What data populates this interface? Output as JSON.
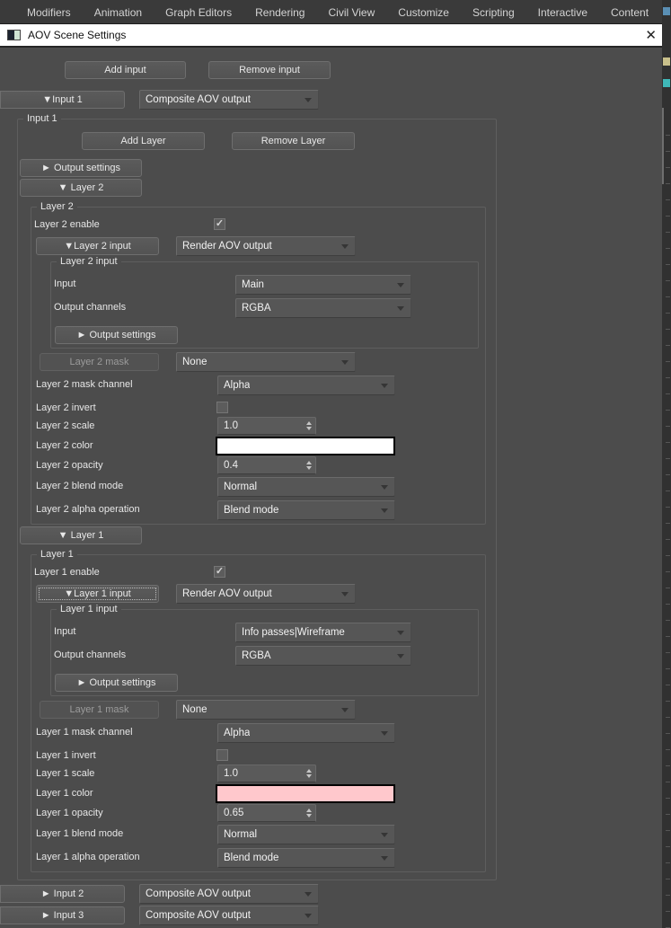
{
  "menu": {
    "items": [
      "Modifiers",
      "Animation",
      "Graph Editors",
      "Rendering",
      "Civil View",
      "Customize",
      "Scripting",
      "Interactive",
      "Content"
    ]
  },
  "titlebar": {
    "title": "AOV Scene Settings",
    "close": "✕"
  },
  "toolbar": {
    "add_input": "Add input",
    "remove_input": "Remove input"
  },
  "input1": {
    "toggle": "▼Input 1",
    "type": "Composite AOV output",
    "group_label": "Input 1",
    "add_layer": "Add Layer",
    "remove_layer": "Remove Layer",
    "output_settings": "► Output settings"
  },
  "layers": [
    {
      "toggle": "▼ Layer 2",
      "group_label": "Layer 2",
      "enable_label": "Layer 2 enable",
      "enable_check": "✓",
      "input_toggle": "▼Layer 2 input",
      "input_type": "Render AOV output",
      "input_group_label": "Layer 2 input",
      "input_label": "Input",
      "input_value": "Main",
      "channels_label": "Output channels",
      "channels_value": "RGBA",
      "output_settings": "► Output settings",
      "mask_label": "Layer 2 mask",
      "mask_value": "None",
      "mask_channel_label": "Layer 2 mask channel",
      "mask_channel_value": "Alpha",
      "invert_label": "Layer 2 invert",
      "invert_check": "",
      "scale_label": "Layer 2 scale",
      "scale_value": "1.0",
      "color_label": "Layer 2 color",
      "color_value": "#ffffff",
      "opacity_label": "Layer 2 opacity",
      "opacity_value": "0.4",
      "blend_label": "Layer 2 blend mode",
      "blend_value": "Normal",
      "alpha_label": "Layer 2 alpha operation",
      "alpha_value": "Blend mode"
    },
    {
      "toggle": "▼ Layer 1",
      "group_label": "Layer 1",
      "enable_label": "Layer 1 enable",
      "enable_check": "✓",
      "input_toggle": "▼Layer 1 input",
      "input_type": "Render AOV output",
      "input_group_label": "Layer 1 input",
      "input_label": "Input",
      "input_value": "Info passes|Wireframe",
      "channels_label": "Output channels",
      "channels_value": "RGBA",
      "output_settings": "► Output settings",
      "mask_label": "Layer 1 mask",
      "mask_value": "None",
      "mask_channel_label": "Layer 1 mask channel",
      "mask_channel_value": "Alpha",
      "invert_label": "Layer 1 invert",
      "invert_check": "",
      "scale_label": "Layer 1 scale",
      "scale_value": "1.0",
      "color_label": "Layer 1 color",
      "color_value": "#ffc8cc",
      "opacity_label": "Layer 1 opacity",
      "opacity_value": "0.65",
      "blend_label": "Layer 1 blend mode",
      "blend_value": "Normal",
      "alpha_label": "Layer 1 alpha operation",
      "alpha_value": "Blend mode"
    }
  ],
  "input2": {
    "toggle": "► Input 2",
    "type": "Composite AOV output"
  },
  "input3": {
    "toggle": "► Input 3",
    "type": "Composite AOV output"
  }
}
